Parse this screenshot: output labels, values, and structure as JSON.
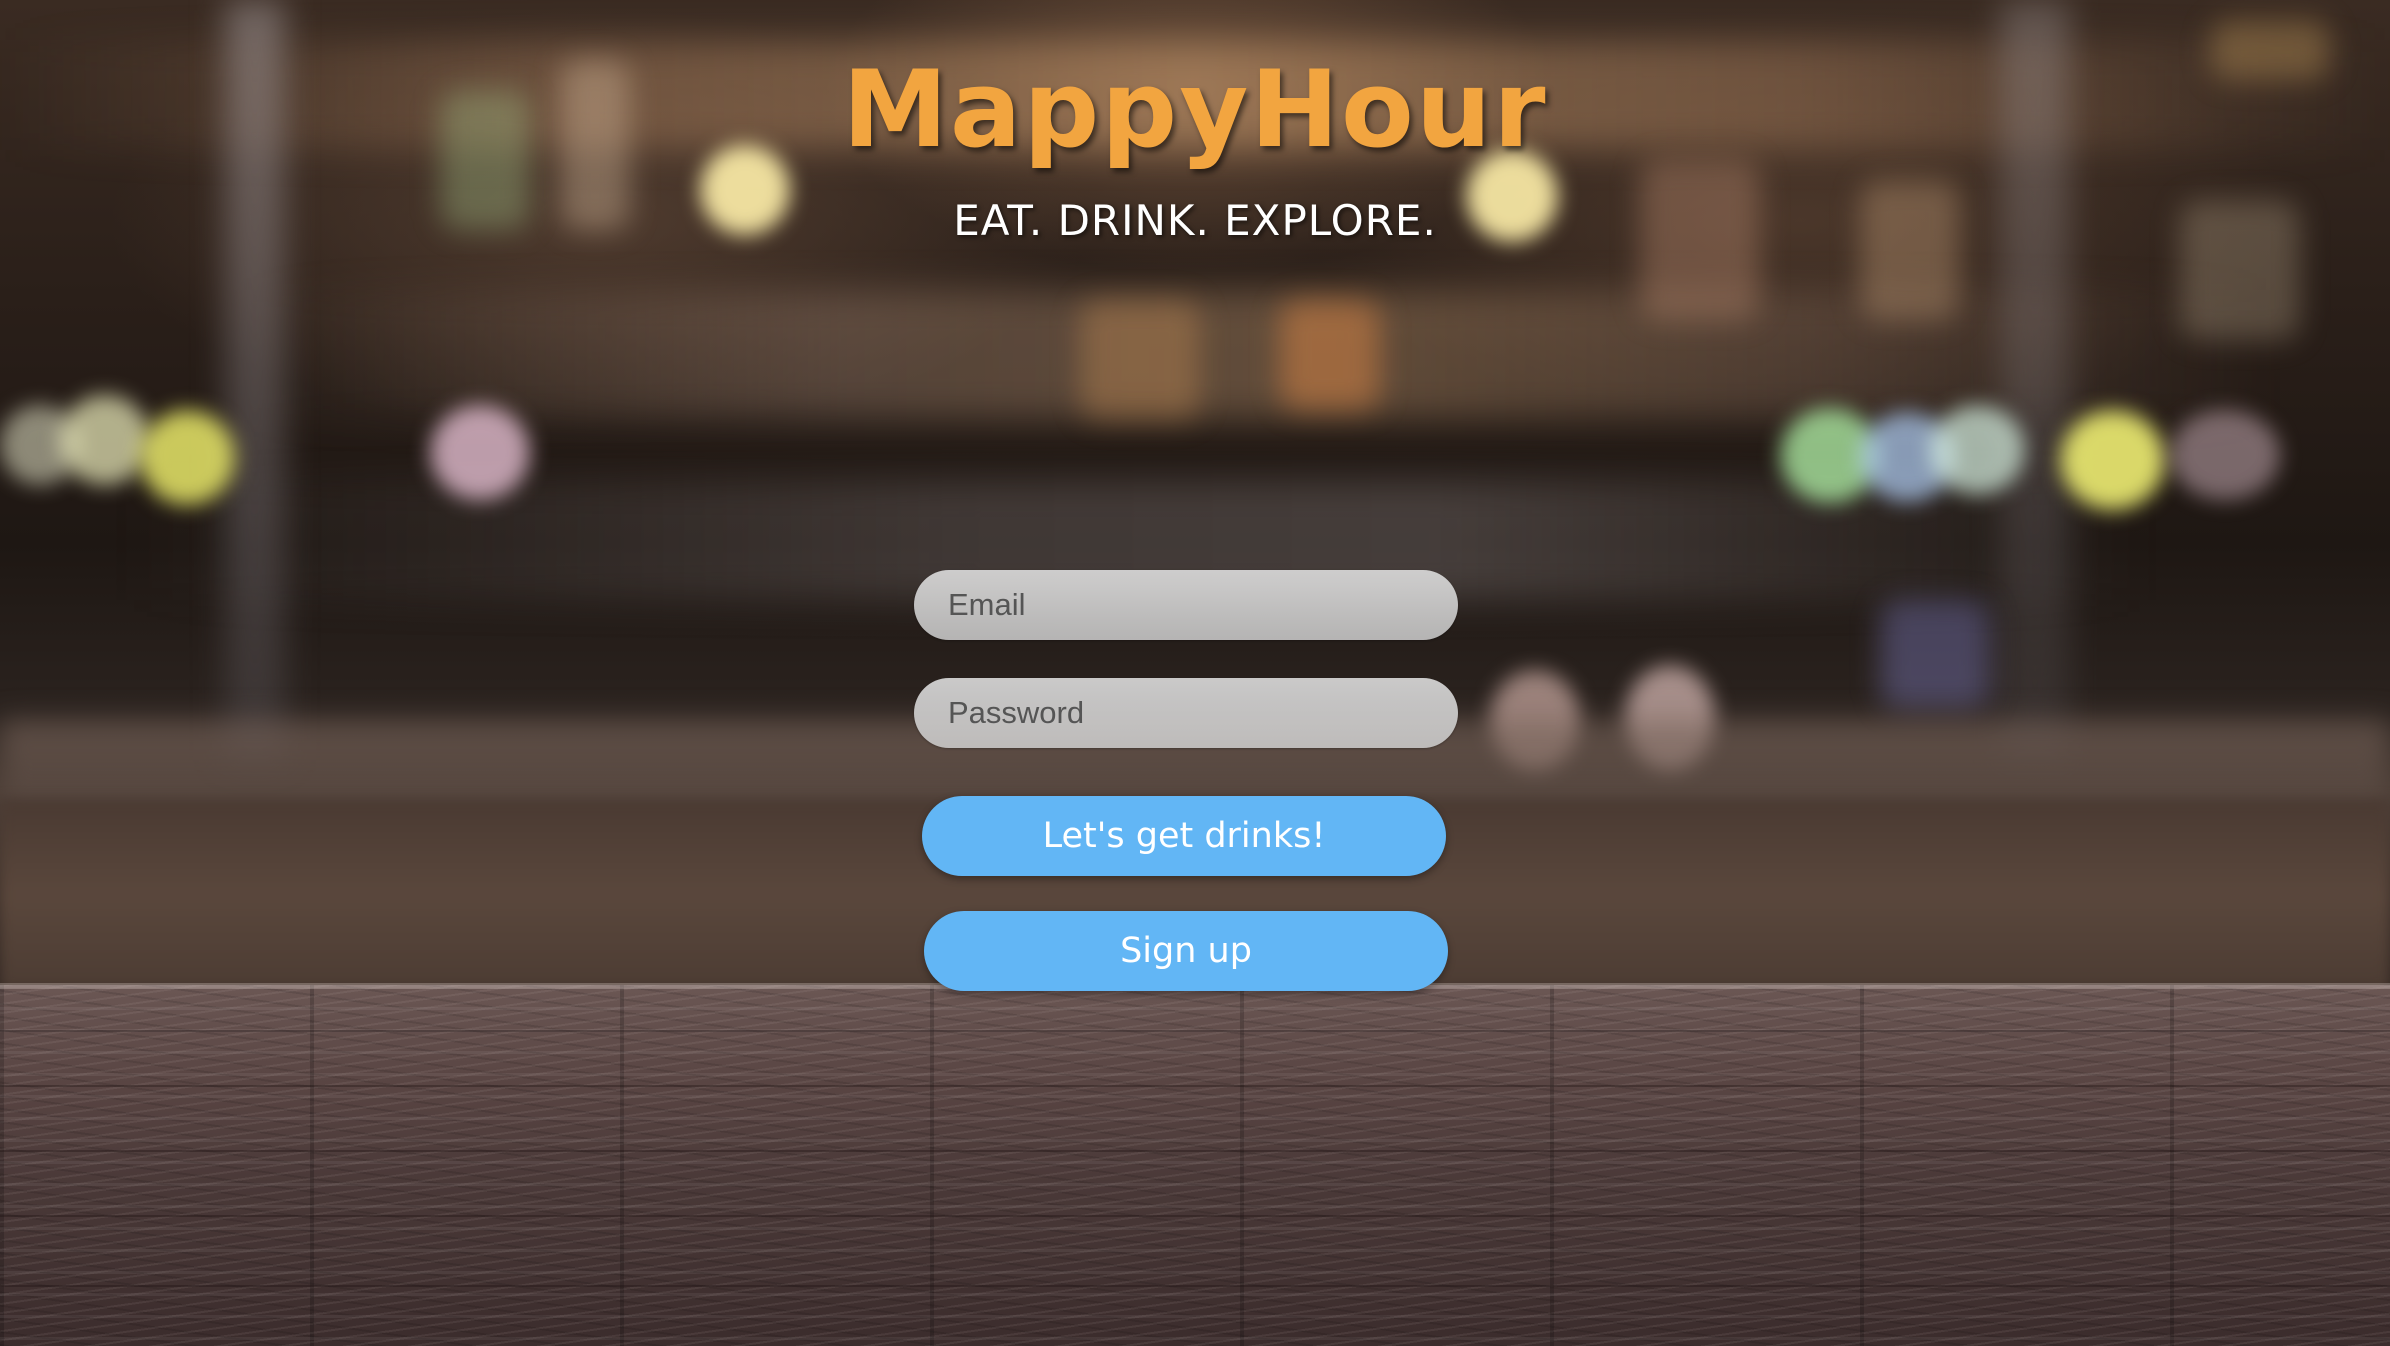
{
  "brand": {
    "title": "MappyHour",
    "tagline": "EAT. DRINK. EXPLORE."
  },
  "login_form": {
    "email": {
      "value": "",
      "placeholder": "Email"
    },
    "password": {
      "value": "",
      "placeholder": "Password"
    },
    "submit_label": "Let's get drinks!",
    "signup_label": "Sign up"
  },
  "colors": {
    "brand": "#f2a540",
    "button": "#62b6f5",
    "button_text": "#ffffff",
    "tagline": "#ffffff"
  }
}
